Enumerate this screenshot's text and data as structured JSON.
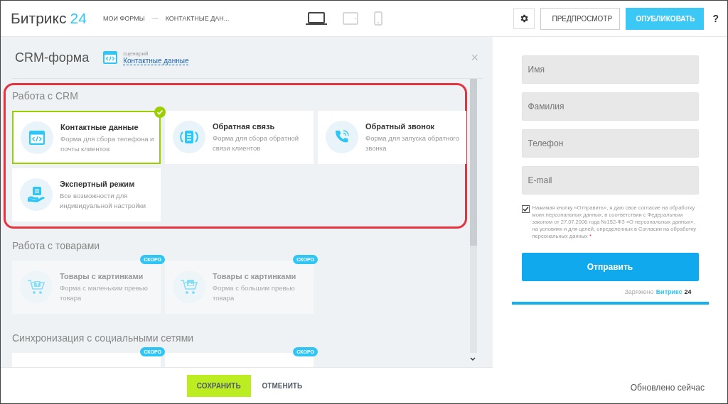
{
  "top_bar": {
    "logo_name": "Битрикс",
    "logo_number": "24",
    "breadcrumbs": [
      "МОИ ФОРМЫ",
      "КОНТАКТНЫЕ ДАН..."
    ],
    "breadcrumb_separator": "—",
    "devices": [
      {
        "kind": "desktop",
        "selected": true
      },
      {
        "kind": "tablet",
        "selected": false
      },
      {
        "kind": "phone",
        "selected": false
      }
    ],
    "preview_button": "ПРЕДПРОСМОТР",
    "publish_button": "ОПУБЛИКОВАТЬ",
    "help": "?"
  },
  "panel": {
    "title": "CRM-форма",
    "scenario_caption": "сценарий",
    "scenario_link": "Контактные данные",
    "close": "×",
    "sections": [
      {
        "title": "Работа с CRM",
        "highlighted": true,
        "cards": [
          {
            "kind": "code",
            "title": "Контактные данные",
            "description": "Форма для сбора телефона и почты клиентов",
            "selected": true,
            "disabled": false
          },
          {
            "kind": "feedback",
            "title": "Обратная связь",
            "description": "Форма для сбора обратной связи клиентов",
            "selected": false,
            "disabled": false
          },
          {
            "kind": "phone",
            "title": "Обратный звонок",
            "description": "Форма для запуска обратного звонка",
            "selected": false,
            "disabled": false
          },
          {
            "kind": "expert",
            "title": "Экспертный режим",
            "description": "Все возможности для индивидуальной настройки",
            "selected": false,
            "disabled": false
          }
        ]
      },
      {
        "title": "Работа с товарами",
        "highlighted": false,
        "cards": [
          {
            "kind": "cart-box",
            "title": "Товары с картинками",
            "description": "Форма с маленьким превью товара",
            "badge": "СКОРО",
            "selected": false,
            "disabled": true
          },
          {
            "kind": "cart-image",
            "title": "Товары с картинками",
            "description": "Форма с большим превью товара",
            "badge": "СКОРО",
            "selected": false,
            "disabled": true
          }
        ]
      },
      {
        "title": "Синхронизация с социальными сетями",
        "highlighted": false,
        "cards": [
          {
            "badge": "СКОРО",
            "selected": false
          },
          {
            "badge": "СКОРО",
            "selected": false
          }
        ]
      }
    ],
    "save_button": "СОХРАНИТЬ",
    "cancel_button": "ОТМЕНИТЬ"
  },
  "preview": {
    "fields": [
      {
        "placeholder": "Имя"
      },
      {
        "placeholder": "Фамилия"
      },
      {
        "placeholder": "Телефон"
      },
      {
        "placeholder": "E-mail"
      }
    ],
    "consent": {
      "checked": true,
      "text": "Нажимая кнопку «Отправить», я даю свое согласие на обработку моих персональных данных, в соответствии с Федеральным законом от 27.07.2006 года №152-ФЗ «О персональных данных», на условиях и для целей, определенных в Согласии на обработку персональных данных",
      "required_mark": "*"
    },
    "submit_button": "Отправить",
    "powered_by": "Заряжено",
    "brand_name": "Битрикс",
    "brand_number": "24",
    "status": "Обновлено сейчас"
  }
}
